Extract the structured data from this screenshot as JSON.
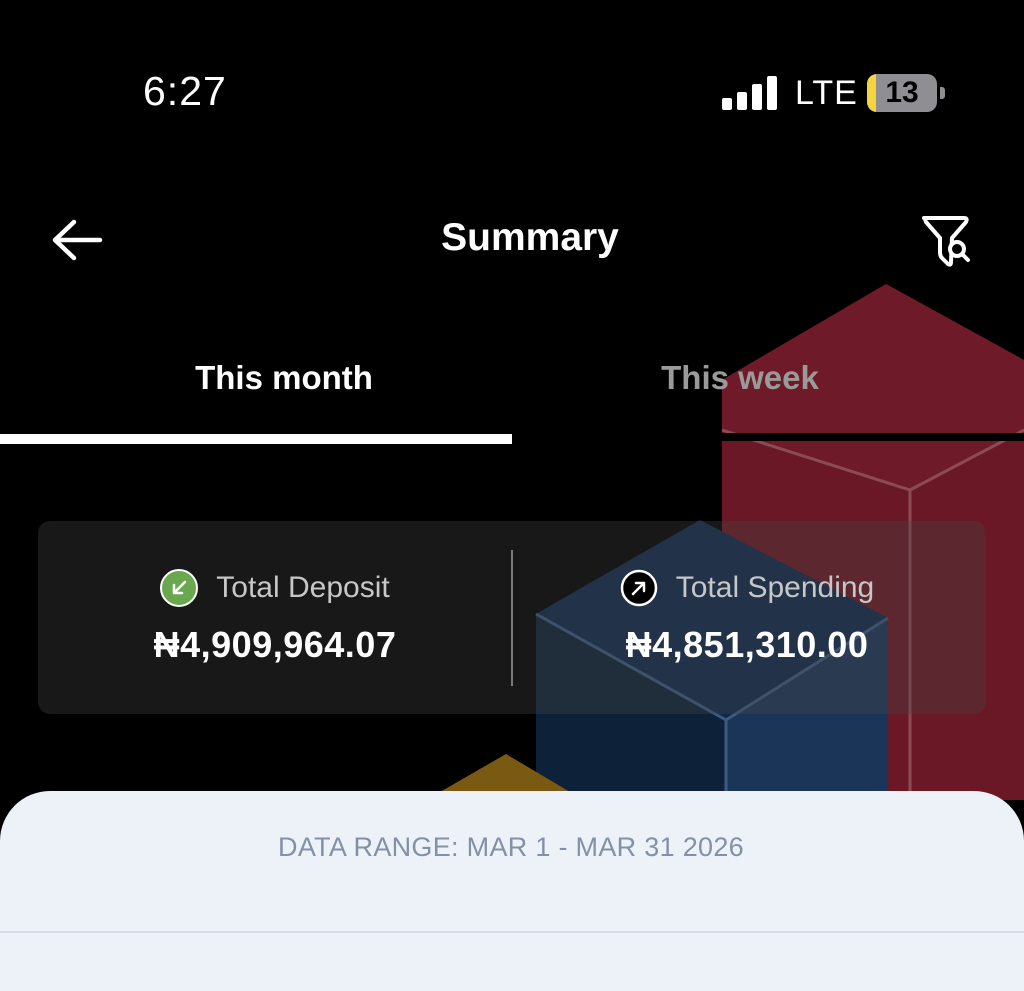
{
  "status_bar": {
    "time": "6:27",
    "network": "LTE",
    "battery_level": "13",
    "battery_color": "#f5d442",
    "signal_icon": "signal-bars-icon",
    "battery_icon": "battery-icon"
  },
  "header": {
    "title": "Summary",
    "back_icon": "arrow-left-icon",
    "filter_icon": "filter-search-icon"
  },
  "tabs": [
    {
      "label": "This month",
      "active": true
    },
    {
      "label": "This week",
      "active": false
    }
  ],
  "summary": {
    "deposit": {
      "label": "Total Deposit",
      "value": "₦4,909,964.07",
      "icon": "arrow-down-left-icon",
      "icon_color": "#6aa84f"
    },
    "spending": {
      "label": "Total Spending",
      "value": "₦4,851,310.00",
      "icon": "arrow-up-right-icon"
    }
  },
  "sheet": {
    "date_range": "DATA RANGE: MAR 1 - MAR 31 2026"
  },
  "colors": {
    "background": "#000000",
    "sheet_bg": "#edf2f9",
    "inactive_tab": "#9a9a9a",
    "cube_red": "#6b1826",
    "cube_blue": "#0d2238",
    "cube_gold": "#7a5a12"
  }
}
